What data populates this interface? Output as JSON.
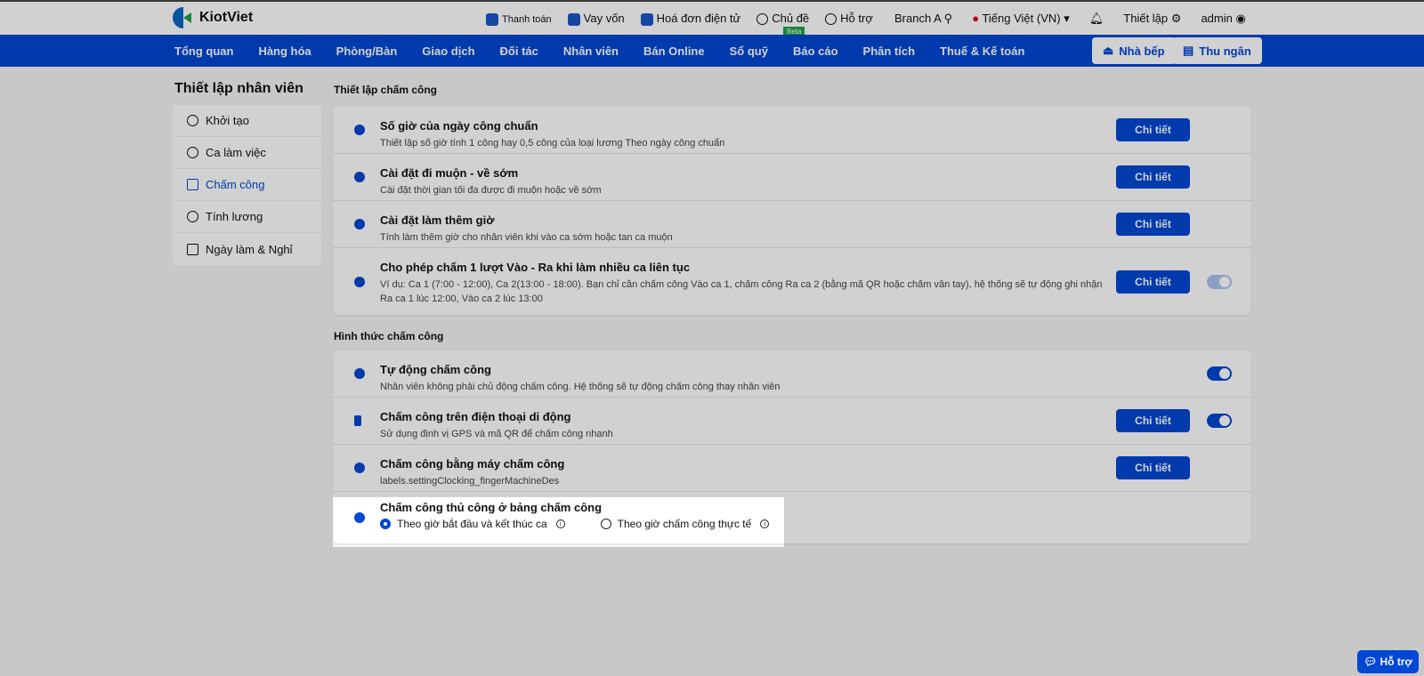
{
  "brand": "KiotViet",
  "top_links": [
    {
      "label": "Thanh toán"
    },
    {
      "label": "Vay vốn"
    },
    {
      "label": "Hoá đơn điện tử"
    },
    {
      "label": "Chủ đề"
    },
    {
      "label": "Hỗ trợ"
    }
  ],
  "beta": "Beta",
  "branch": "Branch A",
  "language": "Tiếng Việt (VN)",
  "settings": "Thiết lập",
  "user": "admin",
  "nav": [
    "Tổng quan",
    "Hàng hóa",
    "Phòng/Bàn",
    "Giao dịch",
    "Đối tác",
    "Nhân viên",
    "Bán Online",
    "Sổ quỹ",
    "Báo cáo",
    "Phân tích",
    "Thuế & Kế toán"
  ],
  "kitchen": "Nhà bếp",
  "cashier": "Thu ngân",
  "sidebar": {
    "title": "Thiết lập nhân viên",
    "items": [
      "Khởi tạo",
      "Ca làm việc",
      "Chấm công",
      "Tính lương",
      "Ngày làm & Nghỉ"
    ]
  },
  "section1": {
    "title": "Thiết lập chấm công",
    "rows": [
      {
        "title": "Số giờ của ngày công chuẩn",
        "desc": "Thiết lập số giờ tính 1 công hay 0,5 công của loại lương Theo ngày công chuẩn",
        "button": "Chi tiết"
      },
      {
        "title": "Cài đặt đi muộn - về sớm",
        "desc": "Cài đặt thời gian tối đa được đi muộn hoặc về sớm",
        "button": "Chi tiết"
      },
      {
        "title": "Cài đặt làm thêm giờ",
        "desc": "Tính làm thêm giờ cho nhân viên khi vào ca sớm hoặc tan ca muộn",
        "button": "Chi tiết"
      },
      {
        "title": "Cho phép chấm 1 lượt Vào - Ra khi làm nhiều ca liên tục",
        "desc": "Ví dụ: Ca 1 (7:00 - 12:00), Ca 2(13:00 - 18:00). Bạn chỉ cần chấm công Vào ca 1, chấm công Ra ca 2 (bằng mã QR hoặc chấm vân tay), hệ thống sẽ tự động ghi nhận Ra ca 1 lúc 12:00, Vào ca 2 lúc 13:00",
        "button": "Chi tiết"
      }
    ]
  },
  "section2": {
    "title": "Hình thức chấm công",
    "rows": [
      {
        "title": "Tự động chấm công",
        "desc": "Nhân viên không phải chủ động chấm công. Hệ thống sẽ tự động chấm công thay nhân viên"
      },
      {
        "title": "Chấm công trên điện thoại di động",
        "desc": "Sử dụng định vị GPS và mã QR để chấm công nhanh",
        "button": "Chi tiết"
      },
      {
        "title": "Chấm công bằng máy chấm công",
        "desc": "labels.settingClocking_fingerMachineDes",
        "button": "Chi tiết"
      },
      {
        "title": "Chấm công thủ công ở bảng chấm công",
        "options": [
          "Theo giờ bắt đầu và kết thúc ca",
          "Theo giờ chấm công thực tế"
        ]
      }
    ]
  },
  "help": "Hỗ trợ"
}
